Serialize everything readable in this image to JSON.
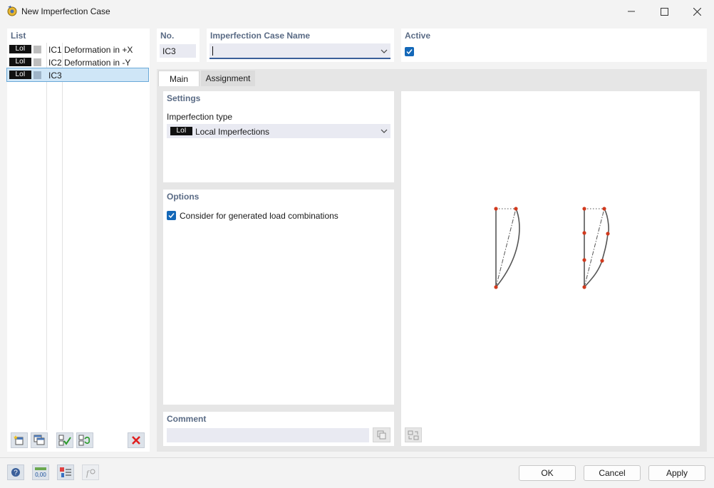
{
  "window": {
    "title": "New Imperfection Case"
  },
  "list_panel": {
    "header": "List",
    "items": [
      {
        "badge": "LoI",
        "code": "IC1",
        "description": "Deformation in +X"
      },
      {
        "badge": "LoI",
        "code": "IC2",
        "description": "Deformation in -Y"
      },
      {
        "badge": "LoI",
        "code": "IC3",
        "description": ""
      }
    ]
  },
  "header_fields": {
    "no_label": "No.",
    "no_value": "IC3",
    "name_label": "Imperfection Case Name",
    "name_value": "",
    "active_label": "Active",
    "active_checked": true
  },
  "tabs": [
    {
      "label": "Main",
      "active": true
    },
    {
      "label": "Assignment",
      "active": false
    }
  ],
  "settings": {
    "header": "Settings",
    "type_label": "Imperfection type",
    "type_badge": "LoI",
    "type_value": "Local Imperfections"
  },
  "options": {
    "header": "Options",
    "consider_label": "Consider for generated load combinations",
    "consider_checked": true
  },
  "comment": {
    "header": "Comment",
    "value": ""
  },
  "buttons": {
    "ok": "OK",
    "cancel": "Cancel",
    "apply": "Apply"
  },
  "footer_icons": [
    "help-icon",
    "units-icon",
    "display-icon",
    "formula-icon"
  ],
  "colors": {
    "accent": "#1468b8",
    "label": "#5a6b85",
    "node": "#d13a1e",
    "close_red": "#e02020"
  }
}
